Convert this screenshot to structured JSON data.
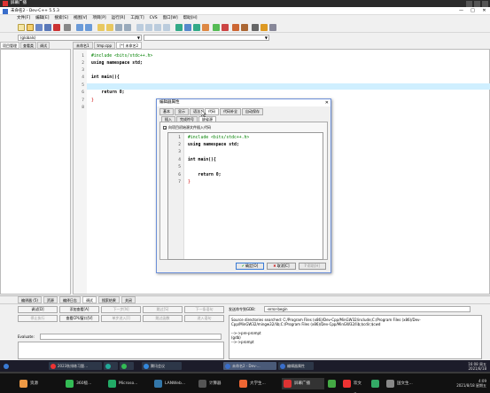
{
  "screen": {
    "title": "屏幕广播"
  },
  "window": {
    "title": "未命名2 - Dev-C++ 5.5.3",
    "min": "—",
    "max": "□",
    "close": "✕"
  },
  "menu": [
    "文件[F]",
    "编辑[E]",
    "搜索[S]",
    "视图[V]",
    "项目[P]",
    "运行[R]",
    "工具[T]",
    "CVS",
    "窗口[W]",
    "帮助[H]"
  ],
  "combos": {
    "left": "(globals)",
    "right": ""
  },
  "left_tabs": [
    "项目管理",
    "查看类",
    "调试"
  ],
  "editor_tabs": [
    "未命名1",
    "tmp.cpp",
    "[*] 未命名2"
  ],
  "editor": {
    "line_numbers": [
      "1",
      "2",
      "3",
      "4",
      "5",
      "6",
      "7",
      "8"
    ],
    "lines": [
      "#include <bits/stdc++.h>",
      "using namespace std;",
      "",
      "int main(){",
      "",
      "    return 0;",
      "}",
      ""
    ]
  },
  "dialog": {
    "title": "编辑器属性",
    "close": "✕",
    "tabs": [
      "基本",
      "显示",
      "语法",
      "代码",
      "代码补全",
      "自动保存"
    ],
    "subtabs": [
      "插入",
      "完成符号",
      "缺省源"
    ],
    "checkbox_label": "向项目初始源文件插入代码",
    "line_numbers": [
      "1",
      "2",
      "3",
      "4",
      "5",
      "6",
      "7"
    ],
    "lines": [
      "#include <bits/stdc++.h>",
      "using namespace std;",
      "",
      "int main(){",
      "",
      "    return 0;",
      "}"
    ],
    "ok": "确定[O]",
    "cancel": "取消[C]",
    "help": "帮助[H]"
  },
  "bottom_tabs": [
    "编译器 (5)",
    "资源",
    "编译日志",
    "调试",
    "搜索结果",
    "关闭"
  ],
  "debug": {
    "buttons_row1": [
      "调试[D]",
      "添加查看[A]",
      "下一步[N]",
      "跳过[S]",
      "下一条语句"
    ],
    "buttons_row2": [
      "停止执行",
      "查看CPU窗口[V]",
      "单步进入[I]",
      "跳过函数",
      "进入语句"
    ],
    "evaluate_label": "Evaluate:",
    "cmd_label": "发送命令到GDB：",
    "cmd_value": "-error-begin",
    "log_lines": [
      "Source directories searched: C:/Program Files (x86)/Dev-Cpp/MinGW32/include;C:/Program Files (x86)/Dev-",
      "Cpp/MinGW32/mingw32/lib;C:/Program Files (x86)/Dev-Cpp/MinGW32/lib;$cdir;$cwd",
      "",
      "-->->pre-prompt",
      "(gdb)",
      "-->->prompt"
    ]
  },
  "status": {
    "row": "行: 5",
    "col": "列: 1",
    "selected": "已选择: 0",
    "total": "总行数: 8",
    "length": "长度: 82",
    "insert": "插入",
    "parsed": "已解析"
  },
  "taskbar_top": [
    "2023秋排练习题...",
    "",
    "",
    "腾讯会议",
    "未命名2 - Dev-...",
    "编辑器属性"
  ],
  "taskbar_bottom": [
    "资源",
    "360极...",
    "Microso...",
    "LANWeb...",
    "计算器",
    "大学生...",
    "屏幕广播",
    "",
    "欢文生...",
    "",
    "国文生..."
  ],
  "clock": {
    "time": "16:08 周五",
    "date": "2021/8/18"
  },
  "clock2": {
    "time": "4:09",
    "date": "2021/8/18 星期五"
  },
  "colors": {
    "accent": "#3a6ecb",
    "highlight_line": "#cfefff",
    "preprocessor": "#008000",
    "number": "#800080"
  }
}
